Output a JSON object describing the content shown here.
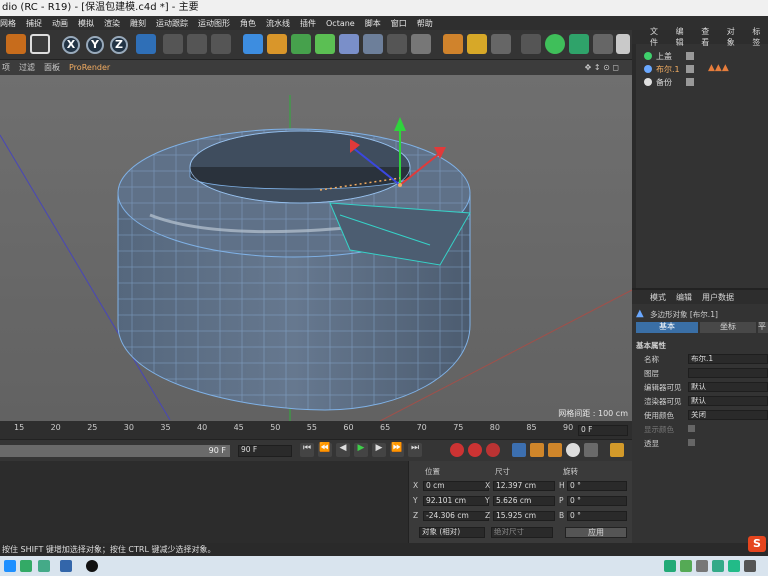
{
  "window": {
    "title": "dio (RC - R19) - [保温包建模.c4d *] - 主要"
  },
  "menu": [
    "网格",
    "捕捉",
    "动画",
    "模拟",
    "渲染",
    "雕刻",
    "运动跟踪",
    "运动图形",
    "角色",
    "流水线",
    "插件",
    "Octane",
    "脚本",
    "窗口",
    "帮助"
  ],
  "toolbar": {
    "axes": [
      "X",
      "Y",
      "Z"
    ]
  },
  "viewport": {
    "menu": [
      "项",
      "过滤",
      "面板",
      "ProRender"
    ],
    "grid_label": "网格间距 : 100 cm"
  },
  "timeline": {
    "ticks": [
      "15",
      "20",
      "25",
      "30",
      "35",
      "40",
      "45",
      "50",
      "55",
      "60",
      "65",
      "70",
      "75",
      "80",
      "85",
      "90"
    ],
    "current_frame": "0 F",
    "end_frame_a": "90 F",
    "end_frame_b": "90 F"
  },
  "coords": {
    "headers": [
      "位置",
      "尺寸",
      "旋转"
    ],
    "rows": [
      {
        "axis": "X",
        "pos": "0 cm",
        "size_axis": "X",
        "size": "12.397 cm",
        "rot_axis": "H",
        "rot": "0 °"
      },
      {
        "axis": "Y",
        "pos": "92.101 cm",
        "size_axis": "Y",
        "size": "5.626 cm",
        "rot_axis": "P",
        "rot": "0 °"
      },
      {
        "axis": "Z",
        "pos": "-24.306 cm",
        "size_axis": "Z",
        "size": "15.925 cm",
        "rot_axis": "B",
        "rot": "0 °"
      }
    ],
    "mode": "对象 (相对)",
    "size_mode": "绝对尺寸",
    "apply": "应用"
  },
  "object_manager": {
    "menu": [
      "文件",
      "编辑",
      "查看",
      "对象",
      "标签"
    ],
    "objects": [
      {
        "name": "上盖",
        "color": "#3fd06c"
      },
      {
        "name": "布尔.1",
        "color": "#6aa8ff"
      },
      {
        "name": "备份",
        "color": "#e0e0e0"
      }
    ]
  },
  "attributes": {
    "menu": [
      "模式",
      "编辑",
      "用户数据"
    ],
    "object_label": "多边形对象 [布尔.1]",
    "tabs": [
      "基本",
      "坐标",
      "平"
    ],
    "section": "基本属性",
    "fields": [
      {
        "label": "名称",
        "value": "布尔.1"
      },
      {
        "label": "图层",
        "value": ""
      },
      {
        "label": "编辑器可见",
        "value": "默认"
      },
      {
        "label": "渲染器可见",
        "value": "默认"
      },
      {
        "label": "使用颜色",
        "value": "关闭"
      },
      {
        "label": "显示颜色",
        "value": ""
      },
      {
        "label": "透显",
        "value": ""
      }
    ]
  },
  "status": "按住 SHIFT 键增加选择对象；按住 CTRL 键减少选择对象。",
  "colors": {
    "accent": "#f3ad62",
    "mesh": "#5d6f86",
    "wire": "#7fb1e6",
    "selected_edge": "#36d2c8"
  }
}
